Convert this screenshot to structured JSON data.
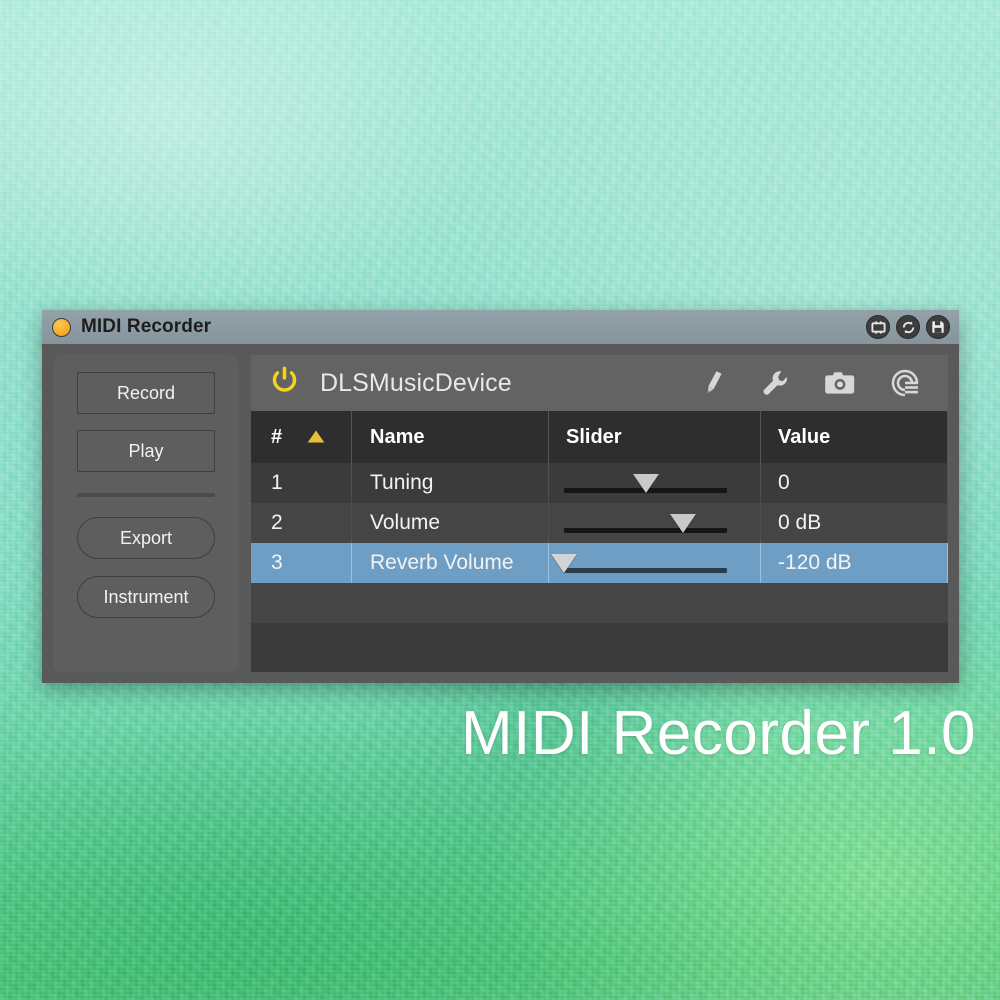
{
  "window": {
    "title": "MIDI Recorder",
    "close_button_color": "#f4a522",
    "titlebar_color": "#8b9aa2",
    "actions": [
      {
        "name": "window-frame-icon",
        "label": "Window"
      },
      {
        "name": "sync-icon",
        "label": "Sync"
      },
      {
        "name": "save-icon",
        "label": "Save"
      }
    ]
  },
  "sidebar": {
    "buttons": [
      {
        "label": "Record",
        "shape": "square"
      },
      {
        "label": "Play",
        "shape": "square"
      },
      {
        "label": "Export",
        "shape": "pill"
      },
      {
        "label": "Instrument",
        "shape": "pill"
      }
    ]
  },
  "plugin": {
    "name": "DLSMusicDevice",
    "power_icon": "power-icon",
    "power_color": "#f2d31e",
    "toolbar": [
      {
        "name": "pencil-icon",
        "label": "Edit"
      },
      {
        "name": "wrench-icon",
        "label": "Settings"
      },
      {
        "name": "camera-icon",
        "label": "Snapshot"
      },
      {
        "name": "preset-list-icon",
        "label": "Presets"
      }
    ]
  },
  "table": {
    "columns": [
      {
        "key": "num",
        "label": "#"
      },
      {
        "key": "name",
        "label": "Name"
      },
      {
        "key": "slider",
        "label": "Slider"
      },
      {
        "key": "value",
        "label": "Value"
      }
    ],
    "sort": {
      "column": "#",
      "direction": "ascending",
      "arrow_color": "#e8c13a"
    },
    "selection_color": "#6f9ec4",
    "rows": [
      {
        "num": "1",
        "name": "Tuning",
        "slider_pct": 50,
        "value": "0",
        "selected": false
      },
      {
        "num": "2",
        "name": "Volume",
        "slider_pct": 73,
        "value": "0 dB",
        "selected": false
      },
      {
        "num": "3",
        "name": "Reverb Volume",
        "slider_pct": 0,
        "value": "-120 dB",
        "selected": true
      }
    ],
    "empty_rows": 2
  },
  "caption": {
    "text": "MIDI Recorder 1.0"
  }
}
